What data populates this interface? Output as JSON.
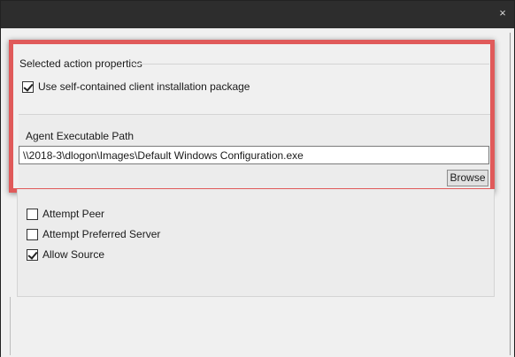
{
  "window": {
    "close_glyph": "×"
  },
  "selected_action": {
    "group_title": "Selected action properties",
    "use_self_contained": {
      "label": "Use self-contained client installation package",
      "checked": true
    },
    "agent_path": {
      "label": "Agent Executable Path",
      "value": "\\\\2018-3\\dlogon\\Images\\Default Windows Configuration.exe"
    },
    "browse_label": "Browse"
  },
  "options": [
    {
      "label": "Attempt Peer",
      "checked": false
    },
    {
      "label": "Attempt Preferred Server",
      "checked": false
    },
    {
      "label": "Allow Source",
      "checked": true
    }
  ],
  "colors": {
    "highlight": "#e05a5a",
    "titlebar": "#2d2d2d",
    "background": "#f0f0f0"
  }
}
